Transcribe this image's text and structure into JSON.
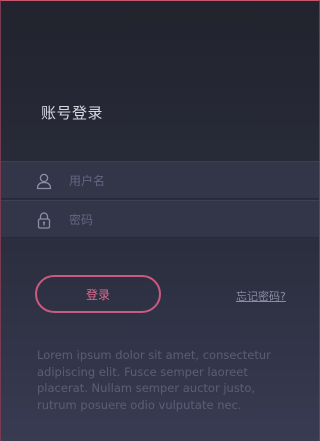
{
  "form": {
    "title": "账号登录",
    "username": {
      "placeholder": "用户名",
      "value": "",
      "icon": "user-icon"
    },
    "password": {
      "placeholder": "密码",
      "value": "",
      "icon": "lock-icon"
    },
    "login_label": "登录",
    "forgot_label": "忘记密码?",
    "description": "Lorem ipsum dolor sit amet, consectetur adipiscing elit. Fusce semper laoreet placerat. Nullam semper auctor justo, rutrum posuere odio vulputate nec."
  },
  "colors": {
    "accent": "#c95a82",
    "background_top": "#21232d",
    "background_bottom": "#383b52",
    "field_bg": "#333649"
  }
}
